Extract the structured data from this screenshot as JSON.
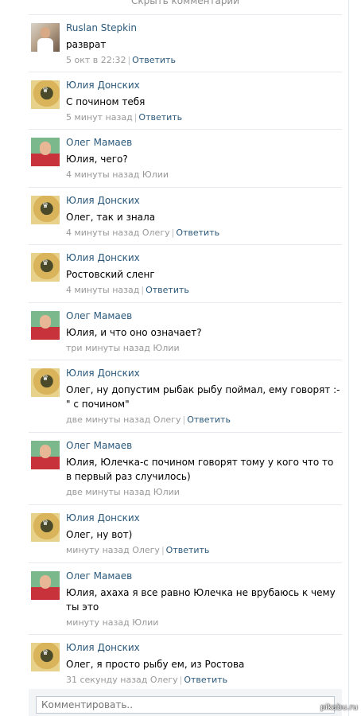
{
  "header": {
    "hide_comments": "Скрыть комментарии"
  },
  "comments": [
    {
      "author": "Ruslan Stepkin",
      "text": "разврат",
      "time": "5 окт в 22:32",
      "reply_label": "Ответить"
    },
    {
      "author": "Юлия Донских",
      "text": "С починoм тебя",
      "time": "5 минут назад",
      "reply_label": "Ответить"
    },
    {
      "author": "Олег Мамаев",
      "text": "Юлия, чего?",
      "time": "4 минуты назад Юлии"
    },
    {
      "author": "Юлия Донских",
      "text": "Олег, так и знала",
      "time": "4 минуты назад Олегу",
      "reply_label": "Ответить"
    },
    {
      "author": "Юлия Донских",
      "text": "Ростовский сленг",
      "time": "4 минуты назад",
      "reply_label": "Ответить"
    },
    {
      "author": "Олег Мамаев",
      "text": "Юлия, и что оно означает?",
      "time": "три минуты назад Юлии"
    },
    {
      "author": "Юлия Донских",
      "text": "Олег, ну допустим рыбак рыбу поймал, ему говорят :- \" с почином\"",
      "time": "две минуты назад Олегу",
      "reply_label": "Ответить"
    },
    {
      "author": "Олег Мамаев",
      "text": "Юлия, Юлечка-с почином говорят тому у кого что то в первый раз случилось)",
      "time": "две минуты назад Юлии"
    },
    {
      "author": "Юлия Донских",
      "text": "Олег, ну вот)",
      "time": "минуту назад Олегу",
      "reply_label": "Ответить"
    },
    {
      "author": "Олег Мамаев",
      "text": "Юлия, ахаха я все равно Юлечка не врубаюсь к чему ты это",
      "time": "минуту назад Юлии"
    },
    {
      "author": "Юлия Донских",
      "text": "Олег, я просто рыбу ем, из Ростова",
      "time": "31 секунду назад Олегу",
      "reply_label": "Ответить"
    }
  ],
  "composer": {
    "placeholder": "Комментировать.."
  },
  "watermark": "pikabu.ru"
}
